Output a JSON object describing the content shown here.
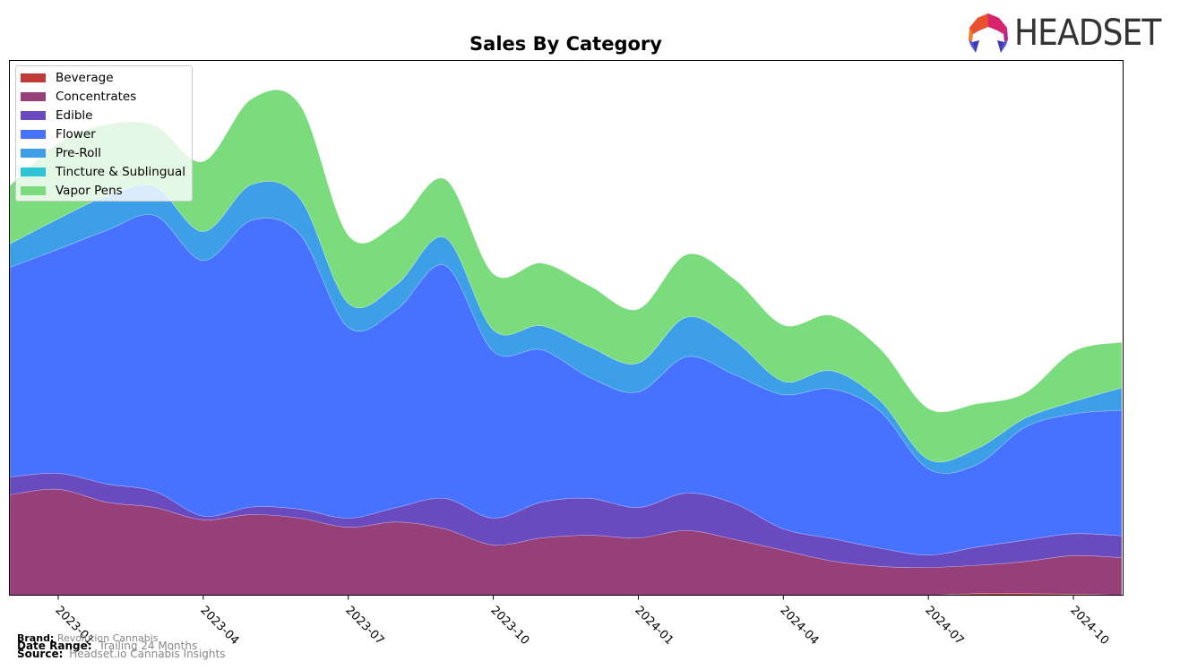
{
  "chart_data": {
    "type": "area",
    "stacked": true,
    "title": "Sales By Category",
    "xlabel": "",
    "ylabel": "",
    "y_tick_labels": [],
    "ylim": [
      0,
      100
    ],
    "y_units": "relative (no y-axis labels shown)",
    "x": [
      "2022-12",
      "2023-01",
      "2023-02",
      "2023-03",
      "2023-04",
      "2023-05",
      "2023-06",
      "2023-07",
      "2023-08",
      "2023-09",
      "2023-10",
      "2023-11",
      "2023-12",
      "2024-01",
      "2024-02",
      "2024-03",
      "2024-04",
      "2024-05",
      "2024-06",
      "2024-07",
      "2024-08",
      "2024-09",
      "2024-10",
      "2024-11"
    ],
    "x_tick_labels": [
      "2023-01",
      "2023-04",
      "2023-07",
      "2023-10",
      "2024-01",
      "2024-04",
      "2024-07",
      "2024-10"
    ],
    "legend_position": "top-left",
    "series": [
      {
        "name": "Beverage",
        "color": "#c23b3b",
        "values": [
          0,
          0,
          0,
          0,
          0,
          0,
          0,
          0,
          0,
          0,
          0,
          0,
          0,
          0,
          0,
          0,
          0,
          0,
          0,
          0,
          0.3,
          0.3,
          0.2,
          0
        ]
      },
      {
        "name": "Concentrates",
        "color": "#963f78",
        "values": [
          18.8,
          19.8,
          17.4,
          16.4,
          14.1,
          15.1,
          14.4,
          12.7,
          13.7,
          12.4,
          9.4,
          10.7,
          11.2,
          10.7,
          12.1,
          10.4,
          8.4,
          6.4,
          5.4,
          5.2,
          5.3,
          6.0,
          7.2,
          7.0
        ]
      },
      {
        "name": "Edible",
        "color": "#6a4bbf",
        "values": [
          3.3,
          3.0,
          3.4,
          3.0,
          0.7,
          1.4,
          1.7,
          1.7,
          2.7,
          5.7,
          5.0,
          6.7,
          6.9,
          5.7,
          7.0,
          6.7,
          4.0,
          4.2,
          3.4,
          2.3,
          3.4,
          4.0,
          4.1,
          4.1
        ]
      },
      {
        "name": "Flower",
        "color": "#4672ff",
        "values": [
          39.2,
          41.9,
          47.4,
          51.6,
          47.8,
          53.6,
          51.4,
          35.7,
          37.0,
          43.6,
          31.2,
          28.5,
          22.6,
          21.6,
          25.5,
          24.1,
          25.1,
          28.0,
          25.6,
          16.1,
          15.4,
          21.1,
          22.4,
          23.5
        ]
      },
      {
        "name": "Pre-Roll",
        "color": "#3d9fe8",
        "values": [
          4.4,
          5.7,
          6.4,
          5.4,
          5.4,
          6.7,
          6.7,
          4.5,
          4.7,
          5.2,
          4.0,
          4.5,
          5.7,
          5.4,
          7.4,
          6.4,
          2.5,
          3.4,
          2.0,
          1.8,
          3.0,
          1.7,
          2.3,
          4.2
        ]
      },
      {
        "name": "Tincture & Sublingual",
        "color": "#2fc4d4",
        "values": [
          0,
          0,
          0,
          0,
          0,
          0,
          0,
          0,
          0,
          0,
          0,
          0,
          0,
          0,
          0,
          0,
          0,
          0,
          0,
          0,
          0,
          0,
          0,
          0
        ]
      },
      {
        "name": "Vapor Pens",
        "color": "#7adc7c",
        "values": [
          10.9,
          14.1,
          13.4,
          11.4,
          13.1,
          16.0,
          17.5,
          12.7,
          11.4,
          10.9,
          10.5,
          11.7,
          11.4,
          10.1,
          11.7,
          11.4,
          10.5,
          10.3,
          9.7,
          9.5,
          8.4,
          4.7,
          9.4,
          8.5
        ]
      }
    ]
  },
  "logo": {
    "text": "HEADSET"
  },
  "footer": {
    "brand_label": "Brand:",
    "brand_value": "Revolution Cannabis",
    "date_range_label": "Date Range:",
    "date_range_value": "Trailing 24 Months",
    "source_label": "Source:",
    "source_value": "Headset.io Cannabis Insights"
  }
}
